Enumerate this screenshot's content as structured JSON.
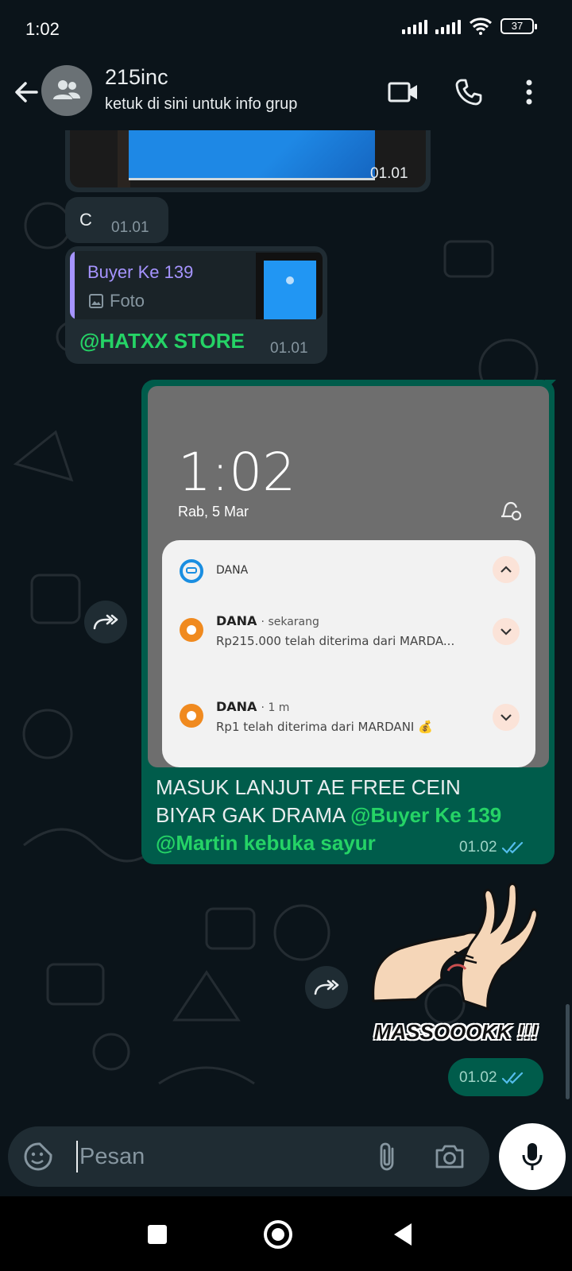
{
  "status_bar": {
    "time": "1:02",
    "battery": "37"
  },
  "header": {
    "title": "215inc",
    "subtitle": "ketuk di sini untuk info grup",
    "icons": [
      "back-arrow-icon",
      "group-avatar-icon",
      "video-call-icon",
      "voice-call-icon",
      "more-menu-icon"
    ]
  },
  "messages": [
    {
      "type": "image-in",
      "time": "01.01"
    },
    {
      "type": "text-in",
      "text": "C",
      "time": "01.01"
    },
    {
      "type": "reply-in",
      "quote_author": "Buyer Ke 139",
      "quote_type": "Foto",
      "mention": "@HATXX STORE",
      "time": "01.01"
    },
    {
      "type": "image-out",
      "screenshot": {
        "time": "1:02",
        "date": "Rab, 5 Mar",
        "app_name": "DANA",
        "notifications": [
          {
            "app": "DANA",
            "meta": "sekarang",
            "body": "Rp215.000 telah diterima dari MARDA..."
          },
          {
            "app": "DANA",
            "meta": "1 m",
            "body": "Rp1 telah diterima dari MARDANI 💰"
          }
        ]
      },
      "caption_line1": "MASUK LANJUT AE FREE CEIN",
      "caption_line2": "BIYAR GAK DRAMA",
      "mention1": "@Buyer Ke 139",
      "mention2": "@Martin kebuka sayur",
      "time": "01.02"
    },
    {
      "type": "sticker-out",
      "sticker_text": "MASSOOOKK !!!",
      "time": "01.02"
    }
  ],
  "input": {
    "placeholder": "Pesan"
  },
  "colors": {
    "background": "#0b141a",
    "incoming_bubble": "#202c33",
    "outgoing_bubble": "#005c4b",
    "mention_green": "#25d366",
    "quote_accent": "#a694ff",
    "read_tick": "#53bdeb"
  }
}
